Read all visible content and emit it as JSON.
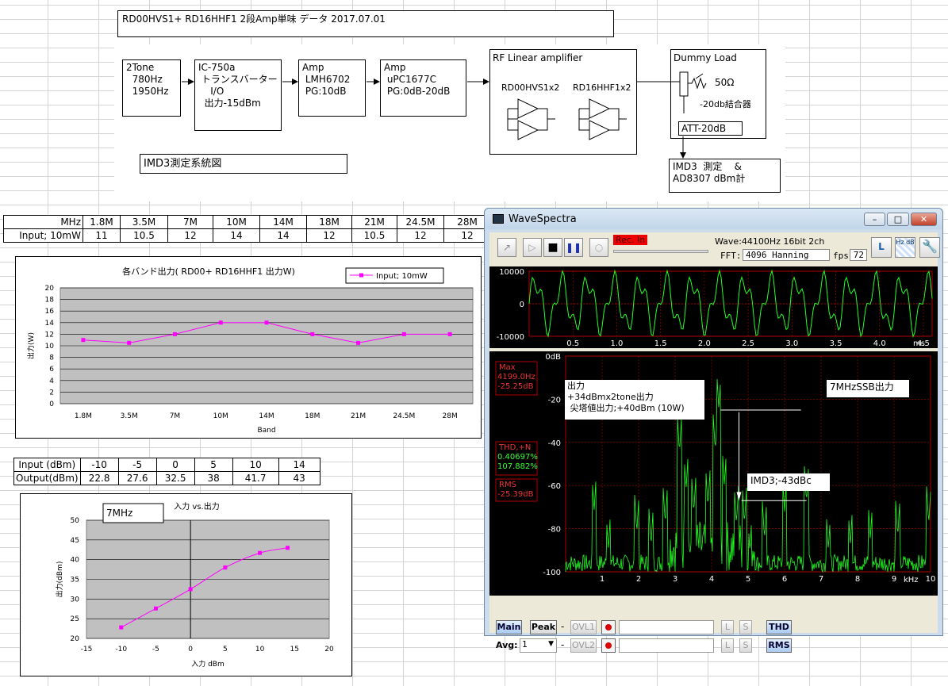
{
  "header": {
    "title": "RD00HVS1+ RD16HHF1 2段Amp単味 データ 2017.07.01"
  },
  "block_diagram": {
    "two_tone": "2Tone\n  780Hz\n  1950Hz",
    "ic750": "IC-750a\n トランスバーター\n    I/O\n  出力-15dBm",
    "amp1": "Amp\n LMH6702\n PG:10dB",
    "amp2": "Amp\n uPC1677C\n PG:0dB-20dB",
    "rf_title": "RF Linear amplifier",
    "rf_left": "RD00HVS1x2",
    "rf_right": "RD16HHF1x2",
    "dummy_title": "Dummy Load",
    "ohm": "50Ω",
    "coupler": "-20db結合器",
    "att": "ATT-20dB",
    "imd": "IMD3  測定    &\nAD8307 dBm計",
    "caption": "IMD3測定系統図"
  },
  "band_table": {
    "headers": [
      "MHz",
      "1.8M",
      "3.5M",
      "7M",
      "10M",
      "14M",
      "18M",
      "21M",
      "24.5M",
      "28M"
    ],
    "row": [
      "Input; 10mW",
      "11",
      "10.5",
      "12",
      "14",
      "14",
      "12",
      "10.5",
      "12",
      "12"
    ]
  },
  "chart_data": [
    {
      "type": "line",
      "title": "各バンド出力( RD00+ RD16HHF1 出力W)",
      "xlabel": "Band",
      "ylabel": "出力(W)",
      "categories": [
        "1.8M",
        "3.5M",
        "7M",
        "10M",
        "14M",
        "18M",
        "21M",
        "24.5M",
        "28M"
      ],
      "series": [
        {
          "name": "Input; 10mW",
          "values": [
            11,
            10.5,
            12,
            14,
            14,
            12,
            10.5,
            12,
            12
          ]
        }
      ],
      "ylim": [
        0,
        20
      ],
      "yticks": [
        "0",
        "2",
        "4",
        "6",
        "8",
        "10",
        "12",
        "14",
        "16",
        "18",
        "20"
      ],
      "grid": true,
      "legend": "top-right",
      "color": "#ff00ff"
    },
    {
      "type": "scatter",
      "title": "入力 vs.出力",
      "annotation": "7MHz",
      "xlabel": "入力 dBm",
      "ylabel": "出力(dBm)",
      "x": [
        -10,
        -5,
        0,
        5,
        10,
        14
      ],
      "y": [
        22.8,
        27.6,
        32.5,
        38,
        41.7,
        43
      ],
      "xlim": [
        -15,
        20
      ],
      "ylim": [
        20,
        50
      ],
      "xticks": [
        "-15",
        "-10",
        "-5",
        "0",
        "5",
        "10",
        "15",
        "20"
      ],
      "yticks": [
        "20",
        "25",
        "30",
        "35",
        "40",
        "45",
        "50"
      ],
      "grid": true,
      "color": "#ff00ff"
    }
  ],
  "io_table": {
    "rows": [
      [
        "Input (dBm)",
        "-10",
        "-5",
        "0",
        "5",
        "10",
        "14"
      ],
      [
        "Output(dBm)",
        "22.8",
        "27.6",
        "32.5",
        "38",
        "41.7",
        "43"
      ]
    ]
  },
  "wavespectra": {
    "title": "WaveSpectra",
    "rec_label": "Rec. In",
    "wave_info": "Wave:44100Hz 16bit 2ch",
    "fft_label": "FFT:",
    "fft_value": "4096 Hanning",
    "fps_label": "fps:",
    "fps_value": "72",
    "wave_y": [
      "10000",
      "0",
      "-10000"
    ],
    "wave_x": [
      "0.5",
      "1.0",
      "1.5",
      "2.0",
      "2.5",
      "3.0",
      "3.5",
      "4.0",
      "4.5"
    ],
    "wave_unit": "ms",
    "spec_y": [
      "0dB",
      "-20",
      "-40",
      "-60",
      "-80",
      "-100"
    ],
    "spec_x": [
      "1",
      "2",
      "3",
      "4",
      "5",
      "6",
      "7",
      "8",
      "9",
      "10"
    ],
    "spec_unit": "kHz",
    "max_label": "Max",
    "max_freq": "4199.0Hz",
    "max_db": "-25.25dB",
    "thd_label": "THD,+N",
    "thd_pct": "0.40697%",
    "thd_db": "107.882%",
    "rms_label": "RMS",
    "rms_db": "-25.39dB",
    "note_output": "出力\n+34dBmx2tone出力\n 尖塔値出力;+40dBm (10W)",
    "note_ssb": "7MHzSSB出力",
    "note_imd": "IMD3;-43dBc",
    "btn_main": "Main",
    "btn_peak": "Peak",
    "dash": "-",
    "ovl1": "OVL1",
    "ovl2": "OVL2",
    "avg_label": "Avg:",
    "avg_value": "1",
    "L": "L",
    "S": "S",
    "thd_btn": "THD",
    "rms_btn": "RMS",
    "trace_color": "#22ff22",
    "grid_color": "#b00000"
  }
}
